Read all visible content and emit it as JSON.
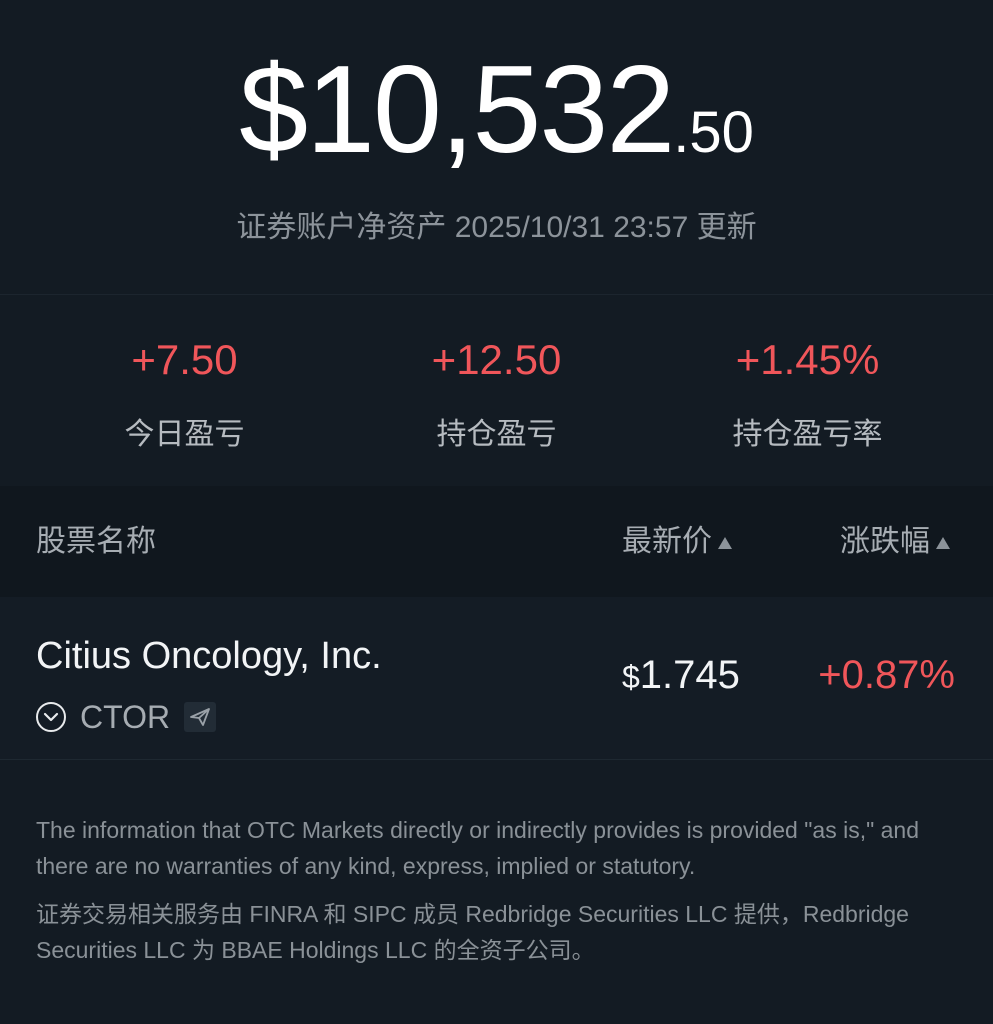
{
  "account": {
    "balance_main": "$10,532",
    "balance_cents": ".50",
    "caption": "证券账户净资产 2025/10/31 23:57 更新"
  },
  "stats": [
    {
      "value": "+7.50",
      "label": "今日盈亏"
    },
    {
      "value": "+12.50",
      "label": "持仓盈亏"
    },
    {
      "value": "+1.45%",
      "label": "持仓盈亏率"
    }
  ],
  "table": {
    "headers": {
      "name": "股票名称",
      "price": "最新价",
      "change": "涨跌幅"
    },
    "rows": [
      {
        "name": "Citius Oncology, Inc.",
        "ticker": "CTOR",
        "price_symbol": "$",
        "price": "1.745",
        "change": "+0.87%"
      }
    ]
  },
  "disclaimer": {
    "english": "The information that OTC Markets directly or indirectly provides is provided \"as is,\" and there are no warranties of any kind, express, implied or statutory.",
    "chinese": "证券交易相关服务由 FINRA 和 SIPC 成员 Redbridge Securities LLC 提供，Redbridge Securities LLC 为 BBAE Holdings LLC 的全资子公司。"
  },
  "colors": {
    "background": "#131b23",
    "gain": "#f0565a",
    "muted_text": "#8c939a"
  },
  "icons": {
    "ticker_badge": "chevron-circle-icon",
    "share": "send-icon",
    "sort": "sort-triangle-icon"
  }
}
